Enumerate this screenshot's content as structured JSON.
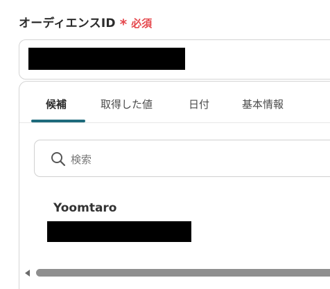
{
  "field": {
    "label": "オーディエンスID",
    "required_star": "*",
    "required_text": "必須"
  },
  "tabs": [
    {
      "label": "候補",
      "active": true
    },
    {
      "label": "取得した値",
      "active": false
    },
    {
      "label": "日付",
      "active": false
    },
    {
      "label": "基本情報",
      "active": false
    }
  ],
  "search": {
    "placeholder": "検索",
    "icon": "search-icon"
  },
  "options": [
    {
      "title": "Yoomtaro"
    }
  ],
  "colors": {
    "required": "#e5484d",
    "tab_accent": "#1d6a7b"
  }
}
